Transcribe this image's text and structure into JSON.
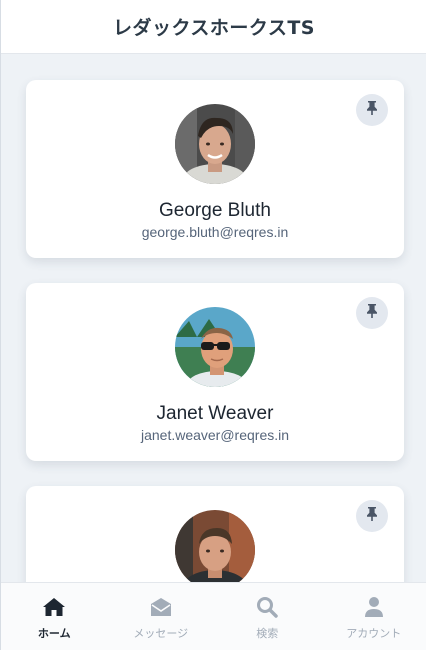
{
  "header": {
    "title": "レダックスホークスTS"
  },
  "cards": [
    {
      "name": "George Bluth",
      "email": "george.bluth@reqres.in",
      "pin_icon": "pin-icon",
      "avatar_icon": "avatar-photo"
    },
    {
      "name": "Janet Weaver",
      "email": "janet.weaver@reqres.in",
      "pin_icon": "pin-icon",
      "avatar_icon": "avatar-photo"
    },
    {
      "name": "",
      "email": "",
      "pin_icon": "pin-icon",
      "avatar_icon": "avatar-photo"
    }
  ],
  "tabs": [
    {
      "label": "ホーム",
      "icon": "home-icon",
      "active": true
    },
    {
      "label": "メッセージ",
      "icon": "envelope-icon",
      "active": false
    },
    {
      "label": "検索",
      "icon": "search-icon",
      "active": false
    },
    {
      "label": "アカウント",
      "icon": "user-icon",
      "active": false
    }
  ],
  "colors": {
    "background": "#eef2f6",
    "card": "#ffffff",
    "title_text": "#2c3a47",
    "muted_text": "#56657a",
    "tab_active": "#1d2631",
    "tab_inactive": "#a2acb8",
    "pin_button_bg": "#e3e8ef"
  }
}
